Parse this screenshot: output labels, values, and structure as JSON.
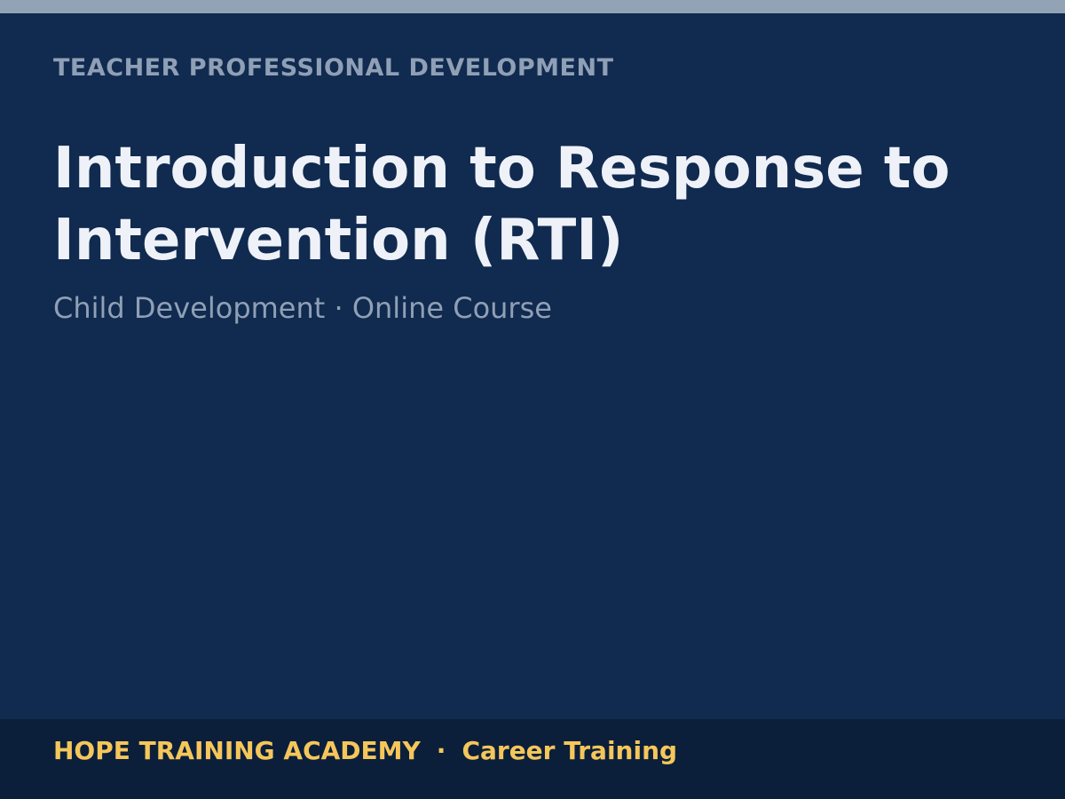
{
  "slide": {
    "eyebrow": "TEACHER PROFESSIONAL DEVELOPMENT",
    "title": "Introduction to Response to Intervention (RTI)",
    "subtitle": "Child Development · Online Course"
  },
  "footer": {
    "organization": "HOPE TRAINING ACADEMY",
    "separator": "·",
    "tagline": "Career Training"
  },
  "colors": {
    "background": "#112a4f",
    "top_strip": "#93a3b6",
    "footer_background": "#0b1f3b",
    "accent": "#f5c65a",
    "title": "#eef2f8",
    "muted_text": "#8fa0b6"
  }
}
